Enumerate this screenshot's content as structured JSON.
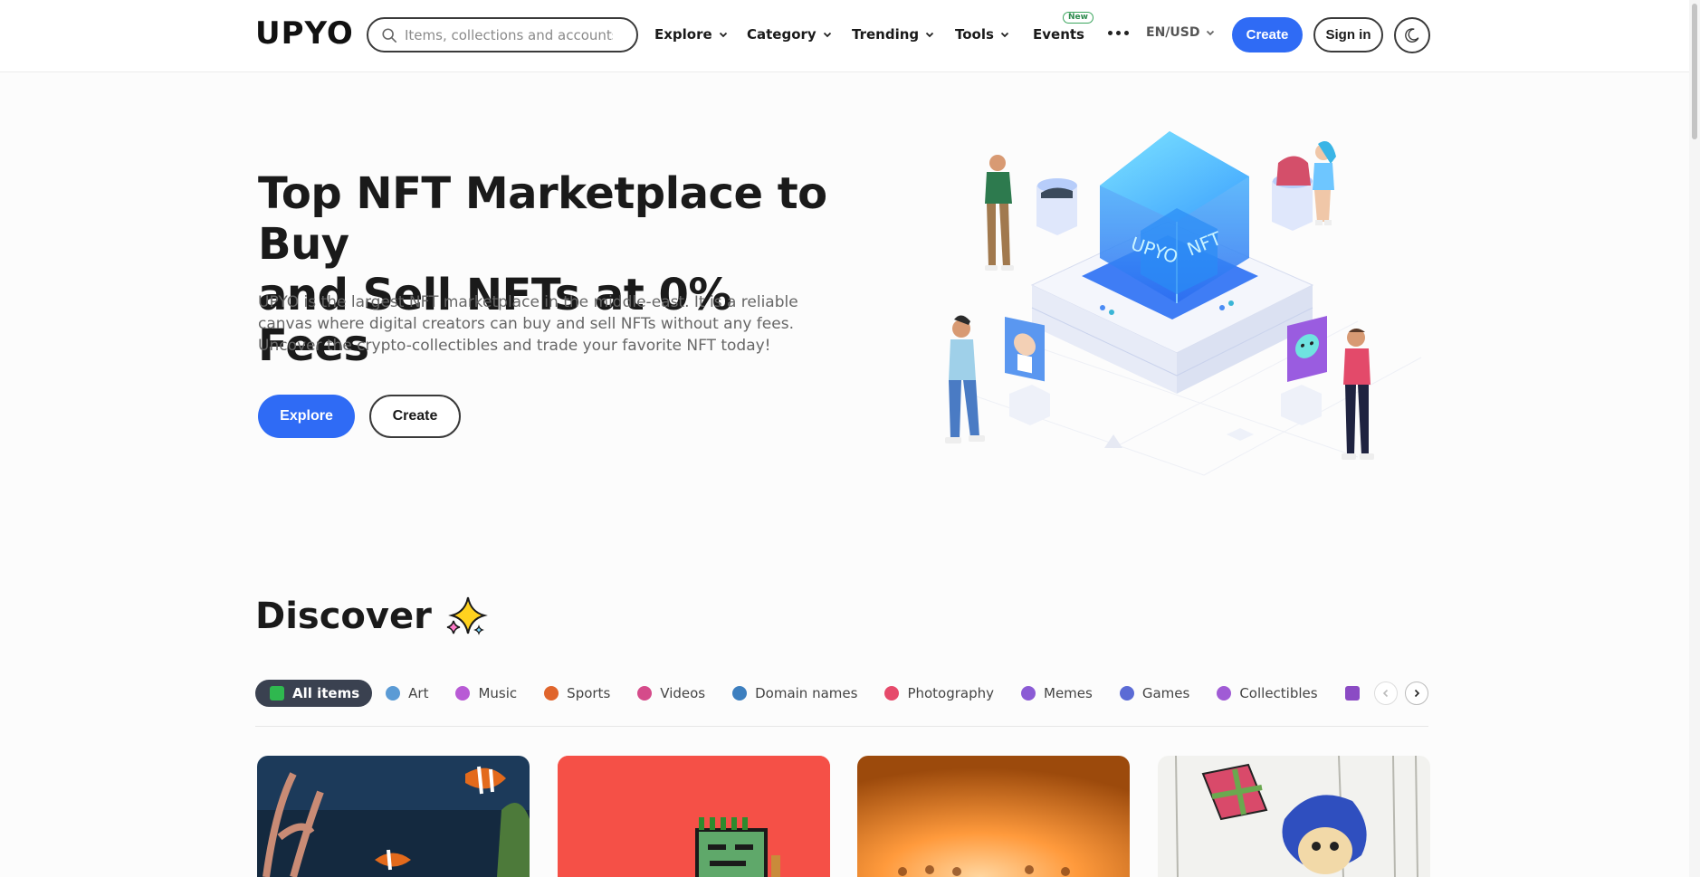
{
  "header": {
    "logo": "UPYO",
    "search_placeholder": "Items, collections and accounts",
    "nav": [
      {
        "label": "Explore"
      },
      {
        "label": "Category"
      },
      {
        "label": "Trending"
      },
      {
        "label": "Tools"
      },
      {
        "label": "Events",
        "badge": "New"
      }
    ],
    "language": "EN/USD",
    "create_label": "Create",
    "signin_label": "Sign in",
    "icons": [
      "search-icon",
      "chevron-down-icon",
      "more-icon",
      "moon-icon"
    ]
  },
  "hero": {
    "title_line1": "Top NFT Marketplace to Buy",
    "title_line2": "and Sell NFTs at 0% Fees",
    "description": "UPYO is the largest NFT marketplace in the middle-east. It is a reliable canvas where digital creators can buy and sell NFTs without any fees. Uncover the crypto-collectibles and trade your favorite NFT today!",
    "explore_label": "Explore",
    "create_label": "Create",
    "illustration_text_left": "UPYO",
    "illustration_text_right": "NFT"
  },
  "discover": {
    "title": "Discover",
    "tabs": [
      {
        "label": "All items",
        "active": true,
        "color": "#2fb84f"
      },
      {
        "label": "Art",
        "color": "#5b9bd5"
      },
      {
        "label": "Music",
        "color": "#b85bd5"
      },
      {
        "label": "Sports",
        "color": "#e0652c"
      },
      {
        "label": "Videos",
        "color": "#d54b8a"
      },
      {
        "label": "Domain names",
        "color": "#3d7fbf"
      },
      {
        "label": "Photography",
        "color": "#e64a6b"
      },
      {
        "label": "Memes",
        "color": "#8b5bd5"
      },
      {
        "label": "Games",
        "color": "#5b6bd5"
      },
      {
        "label": "Collectibles",
        "color": "#a05bd5"
      }
    ]
  },
  "colors": {
    "accent": "#2f6bf5",
    "active_tab": "#3a4150",
    "new_badge": "#2e8b4e"
  }
}
